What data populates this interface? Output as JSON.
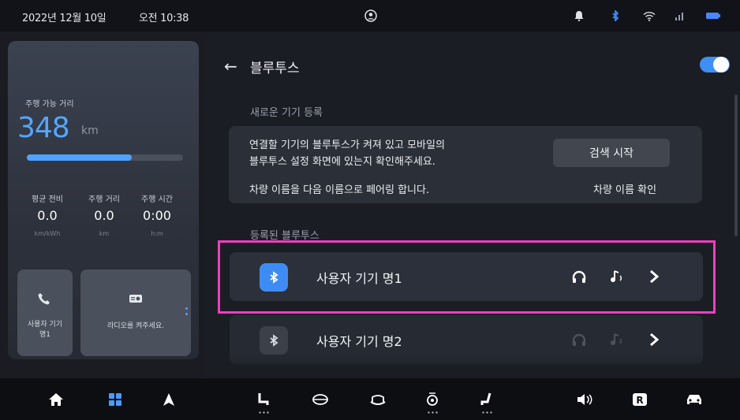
{
  "status": {
    "date": "2022년 12월 10일",
    "time": "오전 10:38"
  },
  "drive": {
    "range_label": "주행 가능 거리",
    "range_value": "348",
    "range_unit": "km",
    "range_fill_fraction": 0.67,
    "stats": [
      {
        "label": "평균 전비",
        "value": "0.0",
        "unit": "km/kWh"
      },
      {
        "label": "주행 거리",
        "value": "0.0",
        "unit": "km"
      },
      {
        "label": "주행 시간",
        "value": "0:00",
        "unit": "h:m"
      }
    ],
    "call_tile_label": "사용자 기기\n명1",
    "radio_tile_label": "라디오를 켜주세요."
  },
  "bluetooth": {
    "title": "블루투스",
    "enabled": true,
    "new_section_label": "새로운 기기 등록",
    "instruction": "연결할 기기의 블루투스가 켜져 있고 모바일의\n블루투스 설정 화면에 있는지 확인해주세요.",
    "scan_button": "검색 시작",
    "pairing_text": "차량 이름을 다음 이름으로 페어링 합니다.",
    "vehicle_name_link": "차량 이름 확인",
    "registered_section_label": "등록된 블루투스",
    "devices": [
      {
        "name": "사용자 기기 명1",
        "active": true
      },
      {
        "name": "사용자 기기 명2",
        "active": false
      }
    ]
  },
  "colors": {
    "accent": "#4ea3ff",
    "highlight": "#ef3fbf",
    "bt_active": "#3e8cf3"
  },
  "icons": [
    "user-icon",
    "bell-icon",
    "bluetooth-icon",
    "wifi-icon",
    "signal-icon",
    "battery-icon",
    "phone-icon",
    "radio-icon",
    "home-icon",
    "apps-icon",
    "navigation-icon",
    "seat-icon",
    "steering-heat-icon",
    "climate-icon",
    "fan-icon",
    "seat-recline-icon",
    "volume-icon",
    "radio-r-icon",
    "car-icon",
    "headphones-icon",
    "music-note-icon",
    "chevron-right-icon",
    "back-arrow-icon"
  ]
}
